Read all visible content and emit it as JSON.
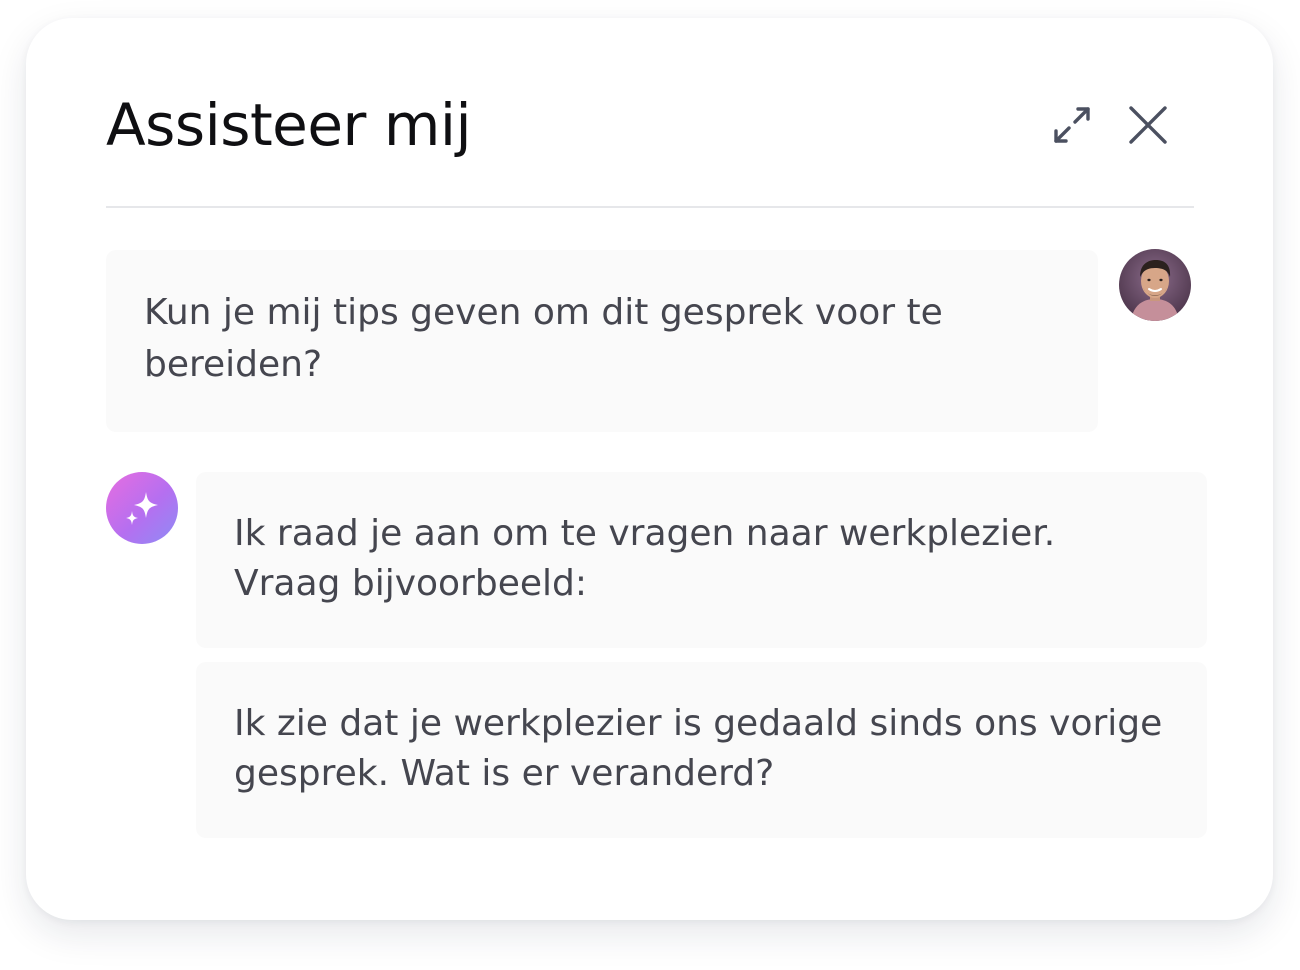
{
  "header": {
    "title": "Assisteer mij",
    "expand_icon": "expand-arrows-icon",
    "close_icon": "close-x-icon"
  },
  "conversation": {
    "user_message": "Kun je mij tips geven om dit gesprek voor te bereiden?",
    "assistant_messages": [
      "Ik raad je aan om te vragen naar werkplezier. Vraag bijvoorbeeld:",
      "Ik zie dat je werkplezier is gedaald sinds ons vorige gesprek. Wat is er veranderd?"
    ],
    "user_avatar_icon": "user-photo-avatar",
    "assistant_avatar_icon": "sparkle-icon"
  },
  "colors": {
    "bubble_background": "#fafafa",
    "text": "#45464f",
    "title": "#0f0f12",
    "icon": "#4b5060",
    "assistant_gradient_start": "#e76ee0",
    "assistant_gradient_end": "#8e8cf5"
  }
}
